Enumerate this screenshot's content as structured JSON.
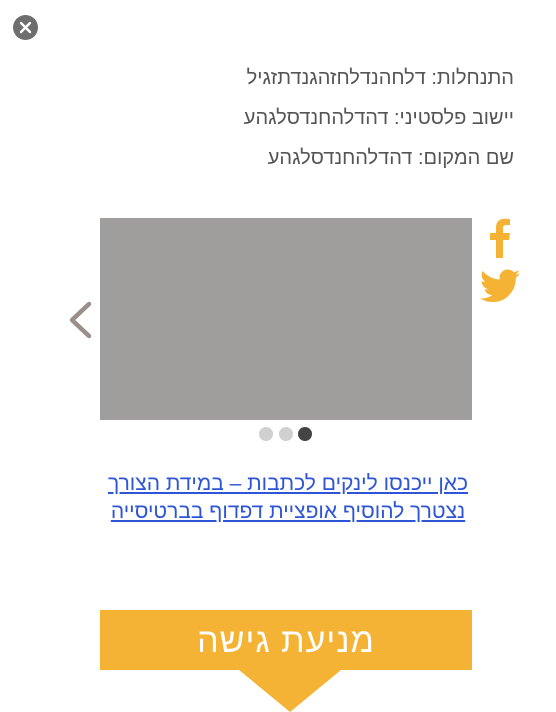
{
  "colors": {
    "accent": "#f5b335",
    "link": "#2d55d6",
    "text": "#555555",
    "placeholder_image": "#9f9e9d",
    "dot_active": "#444444",
    "dot_inactive": "#d0d0d0"
  },
  "icons": {
    "close": "close-icon",
    "facebook": "facebook-icon",
    "twitter": "twitter-icon",
    "prev": "chevron-left-icon"
  },
  "info": {
    "lines": [
      "התנחלות: דלחהנדלחזהגנדתזגיל",
      "יישוב פלסטיני: דהדלהחנדסלגהע",
      "שם המקום: דהדלהחנדסלגהע"
    ]
  },
  "gallery": {
    "slide_count": 3,
    "active_index": 2
  },
  "note_link": "כאן ייכנסו לינקים לכתבות – במידת הצורך נצטרך להוסיף אופציית דפדוף בברטיסייה",
  "cta": {
    "label": "מניעת גישה"
  }
}
